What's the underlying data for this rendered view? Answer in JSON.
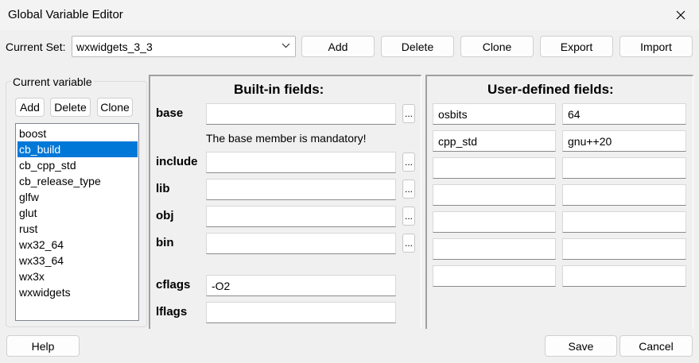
{
  "window": {
    "title": "Global Variable Editor"
  },
  "current_set": {
    "label": "Current Set:",
    "value": "wxwidgets_3_3",
    "buttons": {
      "add": "Add",
      "delete": "Delete",
      "clone": "Clone",
      "export": "Export",
      "import": "Import"
    }
  },
  "current_variable": {
    "title": "Current variable",
    "buttons": {
      "add": "Add",
      "delete": "Delete",
      "clone": "Clone"
    },
    "items": [
      "boost",
      "cb_build",
      "cb_cpp_std",
      "cb_release_type",
      "glfw",
      "glut",
      "rust",
      "wx32_64",
      "wx33_64",
      "wx3x",
      "wxwidgets"
    ],
    "selected": "cb_build"
  },
  "builtin": {
    "title": "Built-in fields:",
    "base_note": "The base member is mandatory!",
    "browse_label": "...",
    "fields": {
      "base": {
        "label": "base",
        "value": ""
      },
      "include": {
        "label": "include",
        "value": ""
      },
      "lib": {
        "label": "lib",
        "value": ""
      },
      "obj": {
        "label": "obj",
        "value": ""
      },
      "bin": {
        "label": "bin",
        "value": ""
      },
      "cflags": {
        "label": "cflags",
        "value": "-O2"
      },
      "lflags": {
        "label": "lflags",
        "value": ""
      }
    }
  },
  "user_defined": {
    "title": "User-defined fields:",
    "rows": [
      {
        "name": "osbits",
        "value": "64"
      },
      {
        "name": "cpp_std",
        "value": "gnu++20"
      },
      {
        "name": "",
        "value": ""
      },
      {
        "name": "",
        "value": ""
      },
      {
        "name": "",
        "value": ""
      },
      {
        "name": "",
        "value": ""
      },
      {
        "name": "",
        "value": ""
      }
    ]
  },
  "footer": {
    "help": "Help",
    "save": "Save",
    "cancel": "Cancel"
  },
  "colors": {
    "selection": "#0078d7",
    "window_bg": "#f0f0f0"
  },
  "icons": [
    "close-icon",
    "chevron-down-icon"
  ]
}
